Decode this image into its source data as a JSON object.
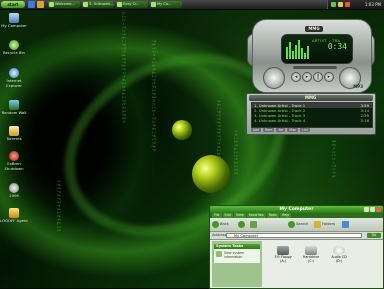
{
  "taskbar": {
    "start_label": "start",
    "buttons": [
      {
        "label": "Welcome..."
      },
      {
        "label": "3. Unknown..."
      },
      {
        "label": "Easy Cr..."
      },
      {
        "label": "My Co..."
      }
    ],
    "clock": "1:03 PM"
  },
  "desktop_icons": [
    {
      "label": "My Computer",
      "icon": "computer-icon"
    },
    {
      "label": "Recycle Bin",
      "icon": "recycle-bin-icon"
    },
    {
      "label": "Internet Explorer",
      "icon": "ie-icon"
    },
    {
      "label": "Random Wall",
      "icon": "picture-icon"
    },
    {
      "label": "Torrents",
      "icon": "folder-icon"
    },
    {
      "label": "ExBren Shutdown",
      "icon": "shutdown-icon"
    },
    {
      "label": "2006",
      "icon": "globe-icon"
    },
    {
      "label": "LOGOFF Agent",
      "icon": "logoff-icon"
    }
  ],
  "player": {
    "logo": "MMG",
    "track_text": "ARTIST - TRA",
    "time": "0:34",
    "badge": "MP3"
  },
  "playlist": {
    "logo": "MMG",
    "tracks": [
      {
        "title": "1. Unknown Artist - Track 1",
        "duration": "3:59",
        "selected": true
      },
      {
        "title": "2. Unknown Artist - Track 2",
        "duration": "3:14",
        "selected": false
      },
      {
        "title": "3. Unknown Artist - Track 3",
        "duration": "2:59",
        "selected": false
      },
      {
        "title": "4. Unknown Artist - Track 4",
        "duration": "3:16",
        "selected": false
      }
    ],
    "buttons": [
      "Add",
      "Rem",
      "Sel",
      "Misc",
      "List"
    ]
  },
  "explorer": {
    "title": "My Computer",
    "menu": [
      "File",
      "Edit",
      "View",
      "Favorites",
      "Tools",
      "Help"
    ],
    "toolbar": {
      "back": "Back",
      "search": "Search",
      "folders": "Folders"
    },
    "address_label": "Address",
    "address_value": "My Computer",
    "go_label": "Go",
    "tasks_header": "System Tasks",
    "task_item": "View system information",
    "drives": [
      {
        "label": "3½ Floppy (A:)"
      },
      {
        "label": "Harddrive (C:)"
      },
      {
        "label": "Audio CD (D:)"
      }
    ]
  }
}
